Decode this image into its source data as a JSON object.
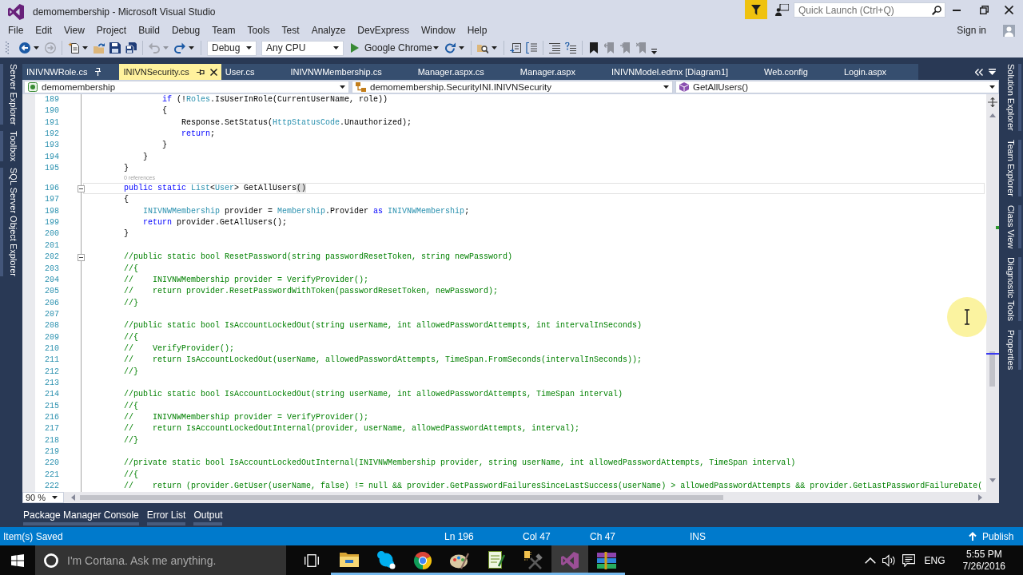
{
  "window": {
    "title": "demomembership - Microsoft Visual Studio"
  },
  "quick_launch": {
    "placeholder": "Quick Launch (Ctrl+Q)"
  },
  "menu": [
    "File",
    "Edit",
    "View",
    "Project",
    "Build",
    "Debug",
    "Team",
    "Tools",
    "Test",
    "Analyze",
    "DevExpress",
    "Window",
    "Help"
  ],
  "account": {
    "label": "Sign in"
  },
  "toolbar": {
    "groups": [
      [
        {
          "kind": "back",
          "disabled": false
        },
        {
          "kind": "forward",
          "disabled": true
        }
      ],
      [
        {
          "kind": "new-project",
          "disabled": false
        },
        {
          "kind": "open",
          "disabled": false
        },
        {
          "kind": "save",
          "disabled": false
        },
        {
          "kind": "save-all",
          "disabled": false
        }
      ],
      [
        {
          "kind": "undo",
          "disabled": true
        },
        {
          "kind": "redo",
          "disabled": false
        }
      ],
      [
        {
          "kind": "combo",
          "value": "Debug"
        },
        {
          "kind": "combo",
          "value": "Any CPU"
        },
        {
          "kind": "run",
          "label": "Google Chrome"
        },
        {
          "kind": "refresh",
          "disabled": false
        }
      ],
      [
        {
          "kind": "find",
          "disabled": false
        }
      ],
      [
        {
          "kind": "block",
          "disabled": false
        },
        {
          "kind": "indent-lines",
          "disabled": false
        }
      ],
      [
        {
          "kind": "lines",
          "disabled": false
        },
        {
          "kind": "comment-lines",
          "disabled": false
        }
      ],
      [
        {
          "kind": "bookmark",
          "disabled": false
        },
        {
          "kind": "bookmark-prev",
          "disabled": true
        },
        {
          "kind": "bookmark-next",
          "disabled": true
        },
        {
          "kind": "bookmark-clear",
          "disabled": true
        }
      ]
    ]
  },
  "left_dock": [
    "Server Explorer",
    "Toolbox",
    "SQL Server Object Explorer"
  ],
  "document_tabs": [
    {
      "label": "INIVNWRole.cs",
      "selected": false,
      "pinned": true
    },
    {
      "label": "INIVNSecurity.cs",
      "selected": true,
      "pinned": false
    },
    {
      "label": "User.cs",
      "selected": false,
      "pinned": false
    },
    {
      "label": "INIVNWMembership.cs",
      "selected": false,
      "pinned": false
    },
    {
      "label": "Manager.aspx.cs",
      "selected": false,
      "pinned": false
    },
    {
      "label": "Manager.aspx",
      "selected": false,
      "pinned": false
    },
    {
      "label": "INIVNModel.edmx [Diagram1]",
      "selected": false,
      "pinned": false
    },
    {
      "label": "Web.config",
      "selected": false,
      "pinned": false
    },
    {
      "label": "Login.aspx",
      "selected": false,
      "pinned": false
    }
  ],
  "navigation_bar": {
    "project": "demomembership",
    "type": "demomembership.SecurityINI.INIVNSecurity",
    "member": "GetAllUsers()"
  },
  "editor": {
    "lines": [
      {
        "kind": "code",
        "number": "189",
        "current": false,
        "fold": false,
        "tokens": [
          {
            "kind": "keyword",
            "text": "                if"
          },
          {
            "kind": "plain",
            "text": " (!"
          },
          {
            "kind": "type",
            "text": "Roles"
          },
          {
            "kind": "plain",
            "text": ".IsUserInRole(CurrentUserName, role))"
          }
        ]
      },
      {
        "kind": "code",
        "number": "190",
        "current": false,
        "fold": false,
        "tokens": [
          {
            "kind": "plain",
            "text": "                {"
          }
        ]
      },
      {
        "kind": "code",
        "number": "191",
        "current": false,
        "fold": false,
        "tokens": [
          {
            "kind": "plain",
            "text": "                    Response.SetStatus("
          },
          {
            "kind": "type",
            "text": "HttpStatusCode"
          },
          {
            "kind": "plain",
            "text": ".Unauthorized);"
          }
        ]
      },
      {
        "kind": "code",
        "number": "192",
        "current": false,
        "fold": false,
        "tokens": [
          {
            "kind": "keyword",
            "text": "                    return"
          },
          {
            "kind": "plain",
            "text": ";"
          }
        ]
      },
      {
        "kind": "code",
        "number": "193",
        "current": false,
        "fold": false,
        "tokens": [
          {
            "kind": "plain",
            "text": "                }"
          }
        ]
      },
      {
        "kind": "code",
        "number": "194",
        "current": false,
        "fold": false,
        "tokens": [
          {
            "kind": "plain",
            "text": "            }"
          }
        ]
      },
      {
        "kind": "code",
        "number": "195",
        "current": false,
        "fold": false,
        "tokens": [
          {
            "kind": "plain",
            "text": "        }"
          }
        ]
      },
      {
        "kind": "codelens",
        "text": "        0 references"
      },
      {
        "kind": "code",
        "number": "196",
        "current": true,
        "fold": true,
        "tokens": [
          {
            "kind": "keyword",
            "text": "        public static "
          },
          {
            "kind": "type",
            "text": "List"
          },
          {
            "kind": "plain",
            "text": "<"
          },
          {
            "kind": "type",
            "text": "User"
          },
          {
            "kind": "plain",
            "text": "> GetAllUsers"
          },
          {
            "kind": "brace-match",
            "text": "()"
          }
        ]
      },
      {
        "kind": "code",
        "number": "197",
        "current": false,
        "fold": false,
        "tokens": [
          {
            "kind": "plain",
            "text": "        {"
          }
        ]
      },
      {
        "kind": "code",
        "number": "198",
        "current": false,
        "fold": false,
        "tokens": [
          {
            "kind": "type",
            "text": "            INIVNWMembership"
          },
          {
            "kind": "plain",
            "text": " provider = "
          },
          {
            "kind": "type",
            "text": "Membership"
          },
          {
            "kind": "plain",
            "text": ".Provider "
          },
          {
            "kind": "keyword",
            "text": "as"
          },
          {
            "kind": "type",
            "text": " INIVNWMembership"
          },
          {
            "kind": "plain",
            "text": ";"
          }
        ]
      },
      {
        "kind": "code",
        "number": "199",
        "current": false,
        "fold": false,
        "tokens": [
          {
            "kind": "keyword",
            "text": "            return"
          },
          {
            "kind": "plain",
            "text": " provider.GetAllUsers();"
          }
        ]
      },
      {
        "kind": "code",
        "number": "200",
        "current": false,
        "fold": false,
        "tokens": [
          {
            "kind": "plain",
            "text": "        }"
          }
        ]
      },
      {
        "kind": "code",
        "number": "201",
        "current": false,
        "fold": false
      },
      {
        "kind": "code",
        "number": "202",
        "current": false,
        "fold": true,
        "tokens": [
          {
            "kind": "comment",
            "text": "        //public static bool ResetPassword(string passwordResetToken, string newPassword)"
          }
        ]
      },
      {
        "kind": "code",
        "number": "203",
        "current": false,
        "fold": false,
        "tokens": [
          {
            "kind": "comment",
            "text": "        //{"
          }
        ]
      },
      {
        "kind": "code",
        "number": "204",
        "current": false,
        "fold": false,
        "tokens": [
          {
            "kind": "comment",
            "text": "        //    INIVNWMembership provider = VerifyProvider();"
          }
        ]
      },
      {
        "kind": "code",
        "number": "205",
        "current": false,
        "fold": false,
        "tokens": [
          {
            "kind": "comment",
            "text": "        //    return provider.ResetPasswordWithToken(passwordResetToken, newPassword);"
          }
        ]
      },
      {
        "kind": "code",
        "number": "206",
        "current": false,
        "fold": false,
        "tokens": [
          {
            "kind": "comment",
            "text": "        //}"
          }
        ]
      },
      {
        "kind": "code",
        "number": "207",
        "current": false,
        "fold": false
      },
      {
        "kind": "code",
        "number": "208",
        "current": false,
        "fold": false,
        "tokens": [
          {
            "kind": "comment",
            "text": "        //public static bool IsAccountLockedOut(string userName, int allowedPasswordAttempts, int intervalInSeconds)"
          }
        ]
      },
      {
        "kind": "code",
        "number": "209",
        "current": false,
        "fold": false,
        "tokens": [
          {
            "kind": "comment",
            "text": "        //{"
          }
        ]
      },
      {
        "kind": "code",
        "number": "210",
        "current": false,
        "fold": false,
        "tokens": [
          {
            "kind": "comment",
            "text": "        //    VerifyProvider();"
          }
        ]
      },
      {
        "kind": "code",
        "number": "211",
        "current": false,
        "fold": false,
        "tokens": [
          {
            "kind": "comment",
            "text": "        //    return IsAccountLockedOut(userName, allowedPasswordAttempts, TimeSpan.FromSeconds(intervalInSeconds));"
          }
        ]
      },
      {
        "kind": "code",
        "number": "212",
        "current": false,
        "fold": false,
        "tokens": [
          {
            "kind": "comment",
            "text": "        //}"
          }
        ]
      },
      {
        "kind": "code",
        "number": "213",
        "current": false,
        "fold": false
      },
      {
        "kind": "code",
        "number": "214",
        "current": false,
        "fold": false,
        "tokens": [
          {
            "kind": "comment",
            "text": "        //public static bool IsAccountLockedOut(string userName, int allowedPasswordAttempts, TimeSpan interval)"
          }
        ]
      },
      {
        "kind": "code",
        "number": "215",
        "current": false,
        "fold": false,
        "tokens": [
          {
            "kind": "comment",
            "text": "        //{"
          }
        ]
      },
      {
        "kind": "code",
        "number": "216",
        "current": false,
        "fold": false,
        "tokens": [
          {
            "kind": "comment",
            "text": "        //    INIVNWMembership provider = VerifyProvider();"
          }
        ]
      },
      {
        "kind": "code",
        "number": "217",
        "current": false,
        "fold": false,
        "tokens": [
          {
            "kind": "comment",
            "text": "        //    return IsAccountLockedOutInternal(provider, userName, allowedPasswordAttempts, interval);"
          }
        ]
      },
      {
        "kind": "code",
        "number": "218",
        "current": false,
        "fold": false,
        "tokens": [
          {
            "kind": "comment",
            "text": "        //}"
          }
        ]
      },
      {
        "kind": "code",
        "number": "219",
        "current": false,
        "fold": false
      },
      {
        "kind": "code",
        "number": "220",
        "current": false,
        "fold": false,
        "tokens": [
          {
            "kind": "comment",
            "text": "        //private static bool IsAccountLockedOutInternal(INIVNWMembership provider, string userName, int allowedPasswordAttempts, TimeSpan interval)"
          }
        ]
      },
      {
        "kind": "code",
        "number": "221",
        "current": false,
        "fold": false,
        "tokens": [
          {
            "kind": "comment",
            "text": "        //{"
          }
        ]
      },
      {
        "kind": "code",
        "number": "222",
        "current": false,
        "fold": false,
        "tokens": [
          {
            "kind": "comment",
            "text": "        //    return (provider.GetUser(userName, false) != null && provider.GetPasswordFailuresSinceLastSuccess(userName) > allowedPasswordAttempts && provider.GetLastPasswordFailureDate("
          }
        ]
      }
    ],
    "zoom": "90 %"
  },
  "right_dock": [
    "Solution Explorer",
    "Team Explorer",
    "Class View",
    "Diagnostic Tools",
    "Properties"
  ],
  "tool_tabs": [
    "Package Manager Console",
    "Error List",
    "Output"
  ],
  "status_bar": {
    "message": "Item(s) Saved",
    "line": "Ln 196",
    "column": "Col 47",
    "character": "Ch 47",
    "mode": "INS",
    "publish": "Publish"
  },
  "taskbar": {
    "search": {
      "placeholder": "I'm Cortana. Ask me anything."
    },
    "apps": [
      {
        "kind": "folder",
        "selected": false
      },
      {
        "kind": "chat",
        "selected": false
      },
      {
        "kind": "browser",
        "selected": false
      },
      {
        "kind": "palette",
        "selected": false
      },
      {
        "kind": "notepad",
        "selected": false
      },
      {
        "kind": "tools",
        "selected": false
      },
      {
        "kind": "ide",
        "selected": true
      },
      {
        "kind": "archive",
        "selected": false
      }
    ],
    "language": "ENG",
    "time": "5:55 PM",
    "date": "7/26/2016"
  }
}
